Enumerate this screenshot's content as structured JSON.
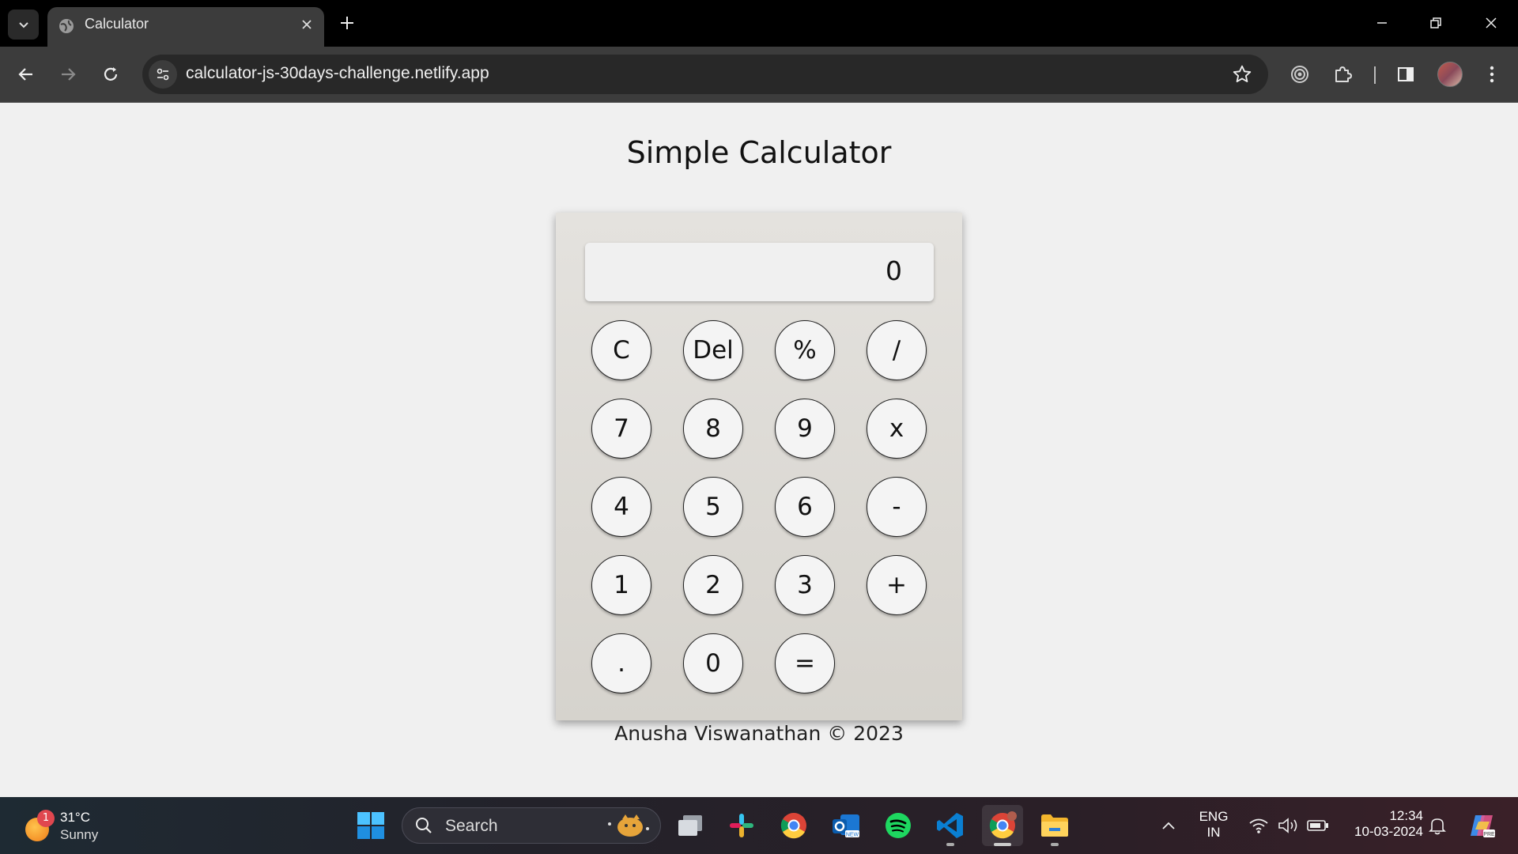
{
  "browser": {
    "tab_title": "Calculator",
    "url": "calculator-js-30days-challenge.netlify.app"
  },
  "page": {
    "title": "Simple Calculator",
    "footer": "Anusha Viswanathan © 2023"
  },
  "calculator": {
    "display": "0",
    "keys": {
      "clear": "C",
      "delete": "Del",
      "percent": "%",
      "divide": "/",
      "seven": "7",
      "eight": "8",
      "nine": "9",
      "multiply": "x",
      "four": "4",
      "five": "5",
      "six": "6",
      "subtract": "-",
      "one": "1",
      "two": "2",
      "three": "3",
      "add": "+",
      "decimal": ".",
      "zero": "0",
      "equals": "="
    }
  },
  "taskbar": {
    "weather": {
      "badge": "1",
      "temp": "31°C",
      "condition": "Sunny"
    },
    "search_label": "Search",
    "language": {
      "line1": "ENG",
      "line2": "IN"
    },
    "clock": {
      "time": "12:34",
      "date": "10-03-2024"
    }
  },
  "icons": [
    "chevron-down-icon",
    "globe-icon",
    "close-icon",
    "plus-icon",
    "minimize-icon",
    "restore-icon",
    "back-icon",
    "forward-icon",
    "reload-icon",
    "site-settings-icon",
    "star-icon",
    "extension-icon",
    "puzzle-icon",
    "side-panel-icon",
    "more-icon",
    "windows-start-icon",
    "search-icon",
    "task-view-icon",
    "slack-icon",
    "chrome-icon",
    "outlook-icon",
    "spotify-icon",
    "vscode-icon",
    "file-explorer-icon",
    "wifi-icon",
    "volume-icon",
    "battery-icon",
    "notification-icon",
    "copilot-icon"
  ]
}
